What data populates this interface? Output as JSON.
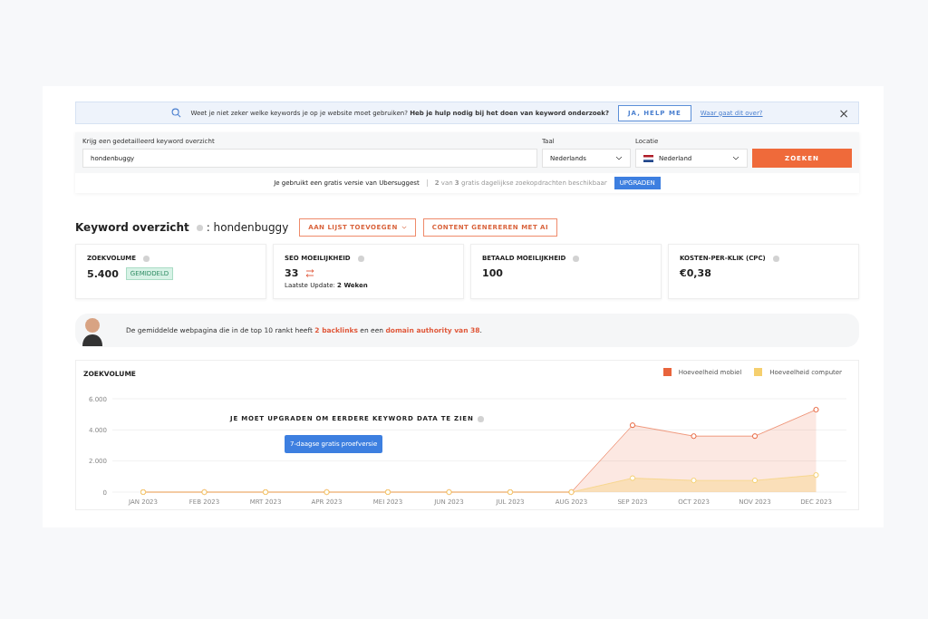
{
  "banner": {
    "question": "Weet je niet zeker welke keywords je op je website moet gebruiken?",
    "question_bold": "Heb je hulp nodig bij het doen van keyword onderzoek?",
    "help_button": "JA, HELP ME",
    "link": "Waar gaat dit over?",
    "close": "×"
  },
  "search": {
    "label": "Krijg een gedetailleerd keyword overzicht",
    "value": "hondenbuggy",
    "language_label": "Taal",
    "language": "Nederlands",
    "location_label": "Locatie",
    "location": "Nederland",
    "button": "ZOEKEN"
  },
  "usage": {
    "text": "Je gebruikt een gratis versie van Ubersuggest",
    "count": "**2** van **3** gratis dagelijkse zoekopdrachten beschikbaar",
    "button": "UPGRADEN"
  },
  "overview": {
    "title": "Keyword overzicht",
    "keyword": ": hondenbuggy",
    "buttons": [
      "AAN LIJST TOEVOEGEN",
      "CONTENT GENEREREN MET AI"
    ]
  },
  "metrics": [
    {
      "label": "ZOEKVOLUME",
      "value": "5.400",
      "badge": "GEMIDDELD"
    },
    {
      "label": "SEO MOEILIJKHEID",
      "value": "33",
      "note": "Laatste Update: **2 Weken**"
    },
    {
      "label": "BETAALD MOEILIJKHEID",
      "value": "100"
    },
    {
      "label": "KOSTEN-PER-KLIK (CPC)",
      "value": "€0,38"
    }
  ],
  "insight": "De gemiddelde webpagina die in de top 10 rankt heeft **2 backlinks** en een **domain authority van 38**.",
  "volume_chart": {
    "title": "ZOEKVOLUME",
    "upgrade_text": "JE MOET UPGRADEN OM EERDERE KEYWORD DATA TE ZIEN",
    "trial_button": "7-daagse gratis proefversie",
    "chart_data": {
      "type": "area",
      "categories": [
        "JAN 2023",
        "FEB 2023",
        "MRT 2023",
        "APR 2023",
        "MEI 2023",
        "JUN 2023",
        "JUL 2023",
        "AUG 2023",
        "SEP 2023",
        "OCT 2023",
        "NOV 2023",
        "DEC 2023"
      ],
      "series": [
        {
          "name": "Hoeveelheid mobiel",
          "color": "#e8643c",
          "values": [
            0,
            0,
            0,
            0,
            0,
            0,
            0,
            0,
            4300,
            3600,
            3600,
            5300
          ]
        },
        {
          "name": "Hoeveelheid computer",
          "color": "#f5cf6e",
          "values": [
            0,
            0,
            0,
            0,
            0,
            0,
            0,
            0,
            900,
            750,
            750,
            1100
          ]
        }
      ],
      "ylim": [
        0,
        6000
      ],
      "yticks": [
        {
          "value": 0,
          "label": "0"
        },
        {
          "value": 2000,
          "label": "2.000"
        },
        {
          "value": 4000,
          "label": "4.000"
        },
        {
          "value": 6000,
          "label": "6.000"
        }
      ]
    }
  }
}
